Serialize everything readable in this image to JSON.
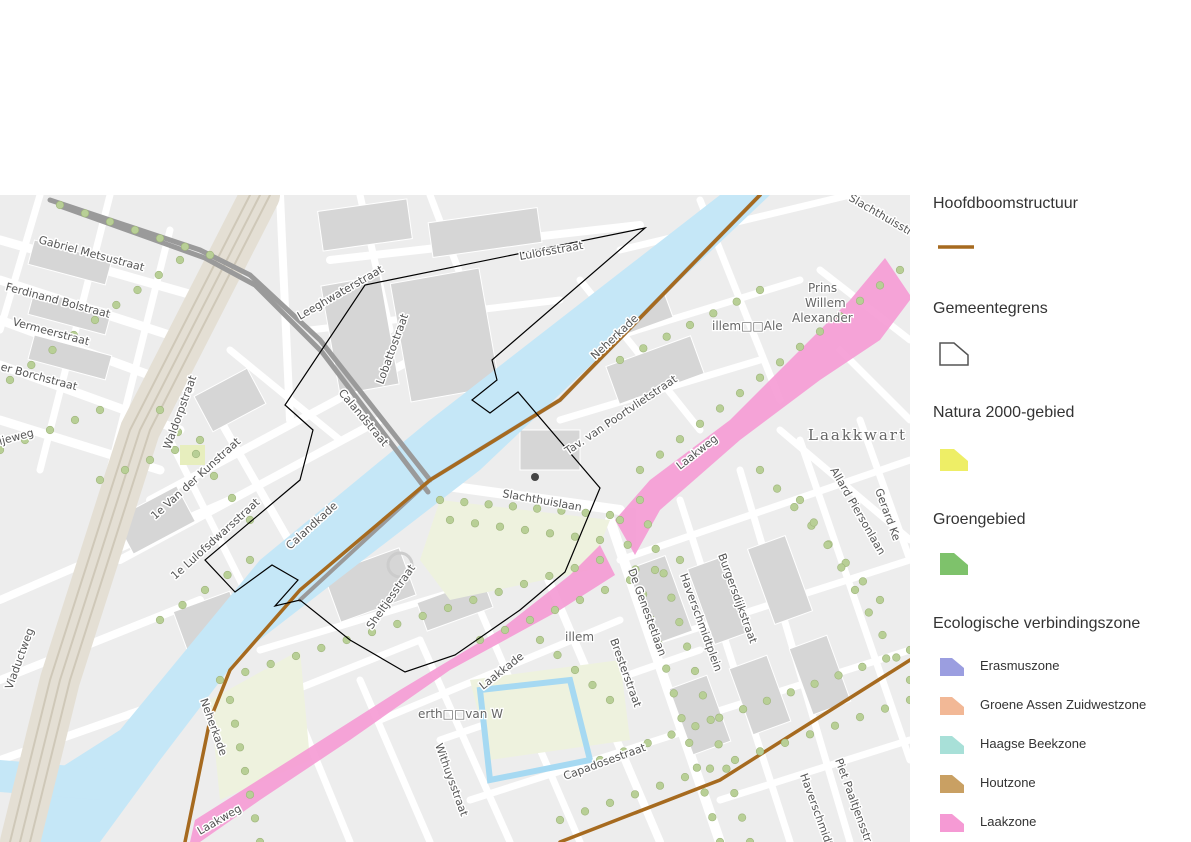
{
  "legend": {
    "hoofdboomstructuur": {
      "title": "Hoofdboomstructuur",
      "color": "#a66a1f"
    },
    "gemeentegrens": {
      "title": "Gemeentegrens",
      "color": "#555555"
    },
    "natura2000": {
      "title": "Natura 2000-gebied",
      "color": "#eeee66"
    },
    "groengebied": {
      "title": "Groengebied",
      "color": "#7ec26b"
    },
    "ecologische": {
      "title": "Ecologische verbindingszone",
      "items": [
        {
          "label": "Erasmuszone",
          "color": "#9b9ee0"
        },
        {
          "label": "Groene Assen Zuidwestzone",
          "color": "#f2b896"
        },
        {
          "label": "Haagse Beekzone",
          "color": "#a8e0d8"
        },
        {
          "label": "Houtzone",
          "color": "#c9a063"
        },
        {
          "label": "Laakzone",
          "color": "#f59ad4"
        }
      ]
    }
  },
  "map": {
    "colors": {
      "water": "#c5e7f7",
      "block": "#d6d6d6",
      "street": "#ffffff",
      "rail": "#9a9a9a",
      "tree": "#b8cf96",
      "green_area": "#eef2de"
    },
    "street_labels": {
      "gabriel_metsustraat": "Gabriel Metsustraat",
      "ferdinand_bolstraat": "Ferdinand Bolstraat",
      "vermeerstraat": "Vermeerstraat",
      "borchstraat": "er Borchstraat",
      "lijeweg": "ijeweg",
      "waldorpstraat": "Waldorpstraat",
      "van_der_kunststraat": "1e Van der Kunstraat",
      "lulofsdwarsstraat": "1e Lulofsdwarsstraat",
      "calandkade": "Calandkade",
      "calandstraat": "Calandstraat",
      "lobattostraat": "Lobattostraat",
      "leeghwaterstraat": "Leeghwaterstraat",
      "lulofsstraat": "Lulofsstraat",
      "neherkade": "Neherkade",
      "van_poortvlietstraat": "Tav. van Poortvlietstraat",
      "slachthuislaan": "Slachthuislaan",
      "sheltjesstraat": "Sheltjesstraat",
      "laakkade": "Laakkade",
      "laakweg": "Laakweg",
      "laakweg_2": "Laakweg",
      "de_genestetlaan": "De Genestetlaan",
      "haverschmidtplein": "Haverschmidtplein",
      "burgersdijkstraat": "Burgersdijkstraat",
      "haverschmidtstraat": "Haverschmidtstraat",
      "bresterstraat": "Bresterstraat",
      "capadosestraat": "Capadosestraat",
      "withuysstraat": "Withuysstraat",
      "viaductweg": "Viaductweg",
      "allard_piersonlaan": "Allard Piersonlaan",
      "slachthuisstraat": "Slachthuisstraat",
      "neherkade_2": "Neherkade",
      "piet_paaltjensstraat": "Piet Paaltjensstraat",
      "gerard_kellerstraat": "Gerard Ke"
    },
    "poi": {
      "prins": "Prins",
      "willem": "Willem",
      "alexander": "Alexander",
      "willem_ale": "illem□□Ale",
      "illem": "illem",
      "erth_van_w": "erth□□van W"
    },
    "area_labels": {
      "laakkwartier": "Laakkwart"
    }
  }
}
